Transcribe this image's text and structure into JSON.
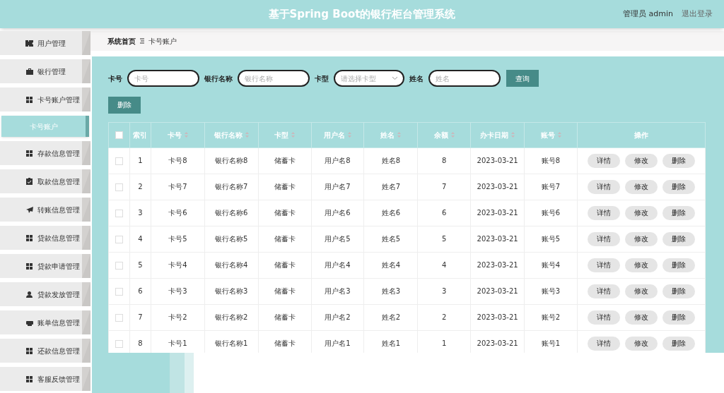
{
  "header": {
    "title": "基于Spring Boot的银行柜台管理系统",
    "user": "管理员 admin",
    "logout": "退出登录"
  },
  "sidebar": {
    "items": [
      {
        "label": "用户管理",
        "selected": false
      },
      {
        "label": "银行管理",
        "selected": false
      },
      {
        "label": "卡号账户管理",
        "selected": false,
        "children": [
          {
            "label": "卡号账户",
            "selected": true
          }
        ]
      },
      {
        "label": "存款信息管理",
        "selected": false
      },
      {
        "label": "取款信息管理",
        "selected": false
      },
      {
        "label": "转账信息管理",
        "selected": false
      },
      {
        "label": "贷款信息管理",
        "selected": false
      },
      {
        "label": "贷款申请管理",
        "selected": false
      },
      {
        "label": "贷款发放管理",
        "selected": false
      },
      {
        "label": "账单信息管理",
        "selected": false
      },
      {
        "label": "还款信息管理",
        "selected": false
      },
      {
        "label": "客服反馈管理",
        "selected": false
      }
    ]
  },
  "breadcrumb": [
    "系统首页",
    "卡号账户"
  ],
  "search": {
    "fields": [
      {
        "label": "卡号",
        "placeholder": "卡号",
        "kind": "input"
      },
      {
        "label": "银行名称",
        "placeholder": "银行名称",
        "kind": "input"
      },
      {
        "label": "卡型",
        "placeholder": "请选择卡型",
        "kind": "select"
      },
      {
        "label": "姓名",
        "placeholder": "姓名",
        "kind": "input"
      }
    ],
    "button": "查询"
  },
  "toolbar": {
    "delete_button": "删除"
  },
  "table": {
    "select_all": {
      "checked": false
    },
    "columns": [
      {
        "label": "索引",
        "sortable": false
      },
      {
        "label": "卡号",
        "sortable": true
      },
      {
        "label": "银行名称",
        "sortable": true
      },
      {
        "label": "卡型",
        "sortable": true
      },
      {
        "label": "用户名",
        "sortable": true
      },
      {
        "label": "姓名",
        "sortable": true
      },
      {
        "label": "余额",
        "sortable": true
      },
      {
        "label": "办卡日期",
        "sortable": true
      },
      {
        "label": "账号",
        "sortable": true
      },
      {
        "label": "操作",
        "sortable": false
      }
    ],
    "rows": [
      {
        "checked": false,
        "cells": [
          "1",
          "卡号8",
          "银行名称8",
          "储蓄卡",
          "用户名8",
          "姓名8",
          "8",
          "2023-03-21",
          "账号8"
        ],
        "actions": [
          "详情",
          "修改",
          "删除"
        ]
      },
      {
        "checked": false,
        "cells": [
          "2",
          "卡号7",
          "银行名称7",
          "储蓄卡",
          "用户名7",
          "姓名7",
          "7",
          "2023-03-21",
          "账号7"
        ],
        "actions": [
          "详情",
          "修改",
          "删除"
        ]
      },
      {
        "checked": false,
        "cells": [
          "3",
          "卡号6",
          "银行名称6",
          "储蓄卡",
          "用户名6",
          "姓名6",
          "6",
          "2023-03-21",
          "账号6"
        ],
        "actions": [
          "详情",
          "修改",
          "删除"
        ]
      },
      {
        "checked": false,
        "cells": [
          "4",
          "卡号5",
          "银行名称5",
          "储蓄卡",
          "用户名5",
          "姓名5",
          "5",
          "2023-03-21",
          "账号5"
        ],
        "actions": [
          "详情",
          "修改",
          "删除"
        ]
      },
      {
        "checked": false,
        "cells": [
          "5",
          "卡号4",
          "银行名称4",
          "储蓄卡",
          "用户名4",
          "姓名4",
          "4",
          "2023-03-21",
          "账号4"
        ],
        "actions": [
          "详情",
          "修改",
          "删除"
        ]
      },
      {
        "checked": false,
        "cells": [
          "6",
          "卡号3",
          "银行名称3",
          "储蓄卡",
          "用户名3",
          "姓名3",
          "3",
          "2023-03-21",
          "账号3"
        ],
        "actions": [
          "详情",
          "修改",
          "删除"
        ]
      },
      {
        "checked": false,
        "cells": [
          "7",
          "卡号2",
          "银行名称2",
          "储蓄卡",
          "用户名2",
          "姓名2",
          "2",
          "2023-03-21",
          "账号2"
        ],
        "actions": [
          "详情",
          "修改",
          "删除"
        ]
      },
      {
        "checked": false,
        "cells": [
          "8",
          "卡号1",
          "银行名称1",
          "储蓄卡",
          "用户名1",
          "姓名1",
          "1",
          "2023-03-21",
          "账号1"
        ],
        "actions": [
          "详情",
          "修改",
          "删除"
        ]
      }
    ]
  }
}
